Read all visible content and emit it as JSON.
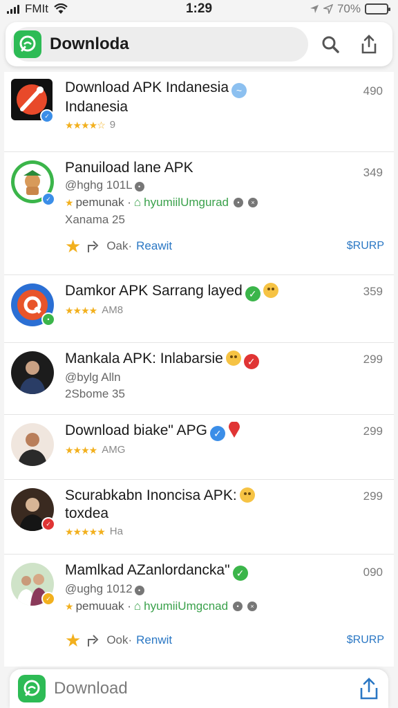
{
  "status_bar": {
    "carrier": "FMIt",
    "time": "1:29",
    "battery": "70%",
    "battery_level": 0.7
  },
  "header": {
    "search_title": "Downloda"
  },
  "items": [
    {
      "title": "Download APK Indanesia",
      "subtitle": "Indanesia",
      "rating_text": "9",
      "price": "490"
    },
    {
      "title": "Panuiload lane APK",
      "handle": "@hghg 101L",
      "meta_left": "pemunak ·",
      "meta_green": "hyumiilUmgurad",
      "line3": "Xanama 25",
      "price": "349",
      "action_label": "Oak·",
      "action_link": "Reawit",
      "action_right": "$RURP"
    },
    {
      "title": "Damkor APK Sarrang layed",
      "rating_text": "AM8",
      "price": "359"
    },
    {
      "title": "Mankala APK: Inlabarsie",
      "handle": "@bylg Alln",
      "line3": "2Sbome 35",
      "price": "299"
    },
    {
      "title": "Download biake\" APG",
      "rating_text": "AMG",
      "price": "299"
    },
    {
      "title": "Scurabkabn Inoncisa APK:",
      "subtitle": "toxdea",
      "rating_text": "Ha",
      "price": "299"
    },
    {
      "title": "Mamlkad AZanlordancka\"",
      "handle": "@ughg 1012",
      "meta_left": "pemuuak ·",
      "meta_green": "hyumiiUmgcnad",
      "price": "090",
      "action_label": "Ook·",
      "action_link": "Renwit",
      "action_right": "$RURP"
    }
  ],
  "bottom_bar": {
    "title": "Download"
  },
  "colors": {
    "accent_green": "#2dbb55",
    "link_blue": "#2a77c4",
    "star": "#f2b01e",
    "verified_blue": "#3b8ee8",
    "verified_green": "#3bb54a",
    "verified_red": "#e03434"
  }
}
